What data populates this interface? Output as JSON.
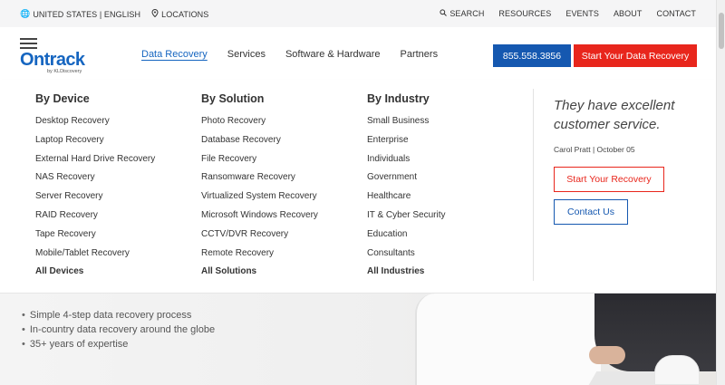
{
  "topbar": {
    "region_label": "UNITED STATES | ENGLISH",
    "locations_label": "LOCATIONS",
    "search_label": "SEARCH",
    "links": [
      "RESOURCES",
      "EVENTS",
      "ABOUT",
      "CONTACT"
    ]
  },
  "header": {
    "logo_text": "Ontrack",
    "logo_subtext": "by KLDiscovery",
    "nav": [
      "Data Recovery",
      "Services",
      "Software & Hardware",
      "Partners"
    ],
    "active_nav": "Data Recovery",
    "phone": "855.558.3856",
    "cta": "Start Your Data Recovery"
  },
  "mega_menu": {
    "by_device": {
      "title": "By Device",
      "items": [
        "Desktop Recovery",
        "Laptop Recovery",
        "External Hard Drive Recovery",
        "NAS Recovery",
        "Server Recovery",
        "RAID Recovery",
        "Tape Recovery",
        "Mobile/Tablet Recovery"
      ],
      "all": "All Devices"
    },
    "by_solution": {
      "title": "By Solution",
      "items": [
        "Photo Recovery",
        "Database Recovery",
        "File Recovery",
        "Ransomware Recovery",
        "Virtualized System Recovery",
        "Microsoft Windows Recovery",
        "CCTV/DVR Recovery",
        "Remote Recovery"
      ],
      "all": "All Solutions"
    },
    "by_industry": {
      "title": "By Industry",
      "items": [
        "Small Business",
        "Enterprise",
        "Individuals",
        "Government",
        "Healthcare",
        "IT & Cyber Security",
        "Education",
        "Consultants"
      ],
      "all": "All Industries"
    },
    "testimonial": {
      "quote": "They have excellent customer service.",
      "author": "Carol Pratt | October 05"
    },
    "recovery_button": "Start Your Recovery",
    "contact_button": "Contact Us"
  },
  "hero": {
    "bullets": [
      "Simple 4-step data recovery process",
      "In-country data recovery around the globe",
      "35+ years of expertise"
    ]
  },
  "colors": {
    "brand_blue": "#1558b0",
    "brand_red": "#e8261c"
  }
}
